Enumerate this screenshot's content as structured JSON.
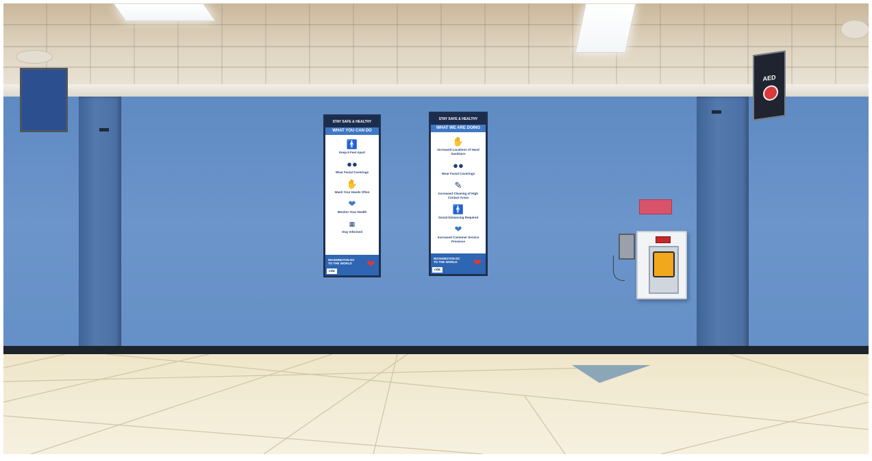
{
  "scene": {
    "setting": "airport terminal wall"
  },
  "posters": [
    {
      "header": "STAY SAFE & HEALTHY",
      "band": "WHAT YOU CAN DO",
      "items": [
        {
          "icon": "people-distance-icon",
          "label": "Keep 6 Feet Apart"
        },
        {
          "icon": "face-mask-icon",
          "label": "Wear Facial Coverings"
        },
        {
          "icon": "hand-wash-icon",
          "label": "Wash Your Hands Often"
        },
        {
          "icon": "heart-plus-icon",
          "label": "Monitor Your Health"
        },
        {
          "icon": "news-icon",
          "label": "Stay Informed"
        }
      ],
      "footer": "WASHINGTON DC TO THE WORLD",
      "logo": "cda"
    },
    {
      "header": "STAY SAFE & HEALTHY",
      "band": "WHAT WE ARE DOING",
      "items": [
        {
          "icon": "cleaning-hand-icon",
          "label": "Increased Locations of Hand Sanitizers"
        },
        {
          "icon": "face-mask-icon",
          "label": "Wear Facial Coverings"
        },
        {
          "icon": "spray-icon",
          "label": "Increased Cleaning of High Contact Areas"
        },
        {
          "icon": "people-distance-icon",
          "label": "Social Distancing Required"
        },
        {
          "icon": "heart-shield-icon",
          "label": "Increased Customer Service Presence"
        }
      ],
      "footer": "WASHINGTON DC TO THE WORLD",
      "logo": "cda"
    }
  ],
  "aed_sign": {
    "text": "AED",
    "color": "#d93a3a"
  },
  "colors": {
    "wall": "#6a93c8",
    "pillar": "#4a6fa3",
    "poster_navy": "#1c2c4c",
    "poster_blue": "#3f79c4",
    "aed_device": "#f2a81d"
  }
}
